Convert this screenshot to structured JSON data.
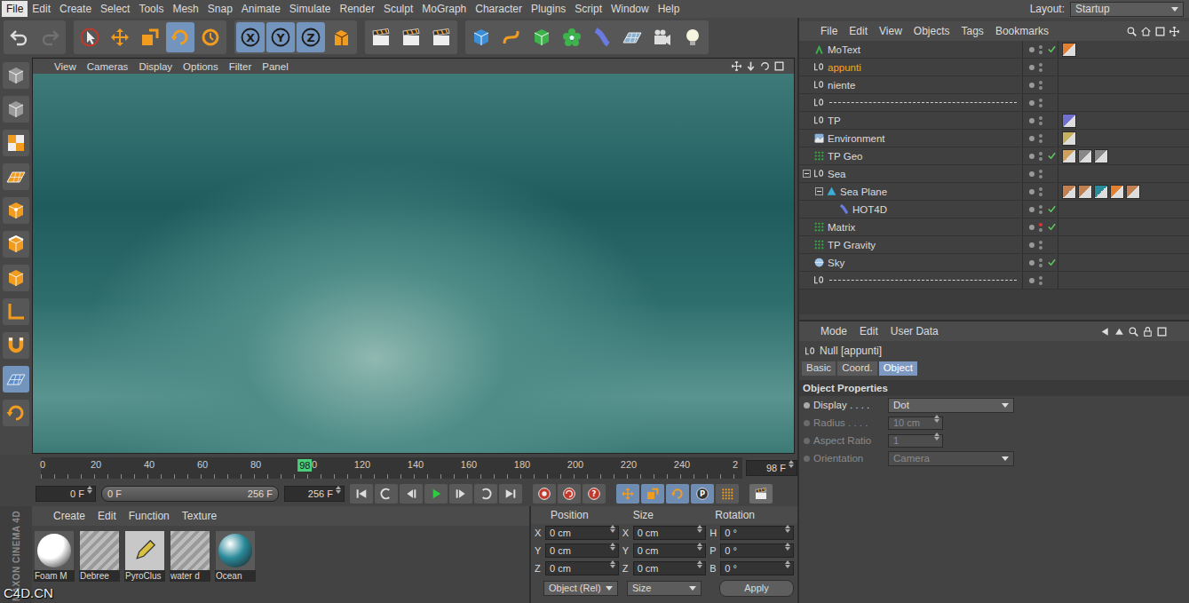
{
  "menubar": {
    "items": [
      {
        "label": "File",
        "selected": true
      },
      {
        "label": "Edit",
        "selected": false
      },
      {
        "label": "Create",
        "selected": false
      },
      {
        "label": "Select",
        "selected": false
      },
      {
        "label": "Tools",
        "selected": false
      },
      {
        "label": "Mesh",
        "selected": false
      },
      {
        "label": "Snap",
        "selected": false
      },
      {
        "label": "Animate",
        "selected": false
      },
      {
        "label": "Simulate",
        "selected": false
      },
      {
        "label": "Render",
        "selected": false
      },
      {
        "label": "Sculpt",
        "selected": false
      },
      {
        "label": "MoGraph",
        "selected": false
      },
      {
        "label": "Character",
        "selected": false
      },
      {
        "label": "Plugins",
        "selected": false
      },
      {
        "label": "Script",
        "selected": false
      },
      {
        "label": "Window",
        "selected": false
      },
      {
        "label": "Help",
        "selected": false
      }
    ],
    "layout_label": "Layout:",
    "layout_value": "Startup"
  },
  "toolbar": [
    {
      "tools": [
        {
          "kind": "undo",
          "label": "",
          "selected": false,
          "disabled": false
        },
        {
          "kind": "redo",
          "label": "",
          "selected": false,
          "disabled": true
        }
      ]
    },
    {
      "tools": [
        {
          "kind": "select",
          "label": "",
          "selected": false,
          "disabled": false
        },
        {
          "kind": "move",
          "label": "",
          "selected": false,
          "disabled": false
        },
        {
          "kind": "scale",
          "label": "",
          "selected": false,
          "disabled": false
        },
        {
          "kind": "rotate",
          "label": "",
          "selected": true,
          "disabled": false
        },
        {
          "kind": "recent",
          "label": "",
          "selected": false,
          "disabled": false
        }
      ]
    },
    {
      "tools": [
        {
          "kind": "axis",
          "label": "X",
          "selected": true,
          "disabled": false
        },
        {
          "kind": "axis",
          "label": "Y",
          "selected": true,
          "disabled": false
        },
        {
          "kind": "axis",
          "label": "Z",
          "selected": true,
          "disabled": false
        },
        {
          "kind": "coord",
          "label": "",
          "selected": false,
          "disabled": false
        }
      ]
    },
    {
      "tools": [
        {
          "kind": "clapper",
          "label": "",
          "selected": false,
          "disabled": false
        },
        {
          "kind": "clapper",
          "label": "",
          "selected": false,
          "disabled": false
        },
        {
          "kind": "clapper",
          "label": "",
          "selected": false,
          "disabled": false
        }
      ]
    },
    {
      "tools": [
        {
          "kind": "cube",
          "label": "",
          "selected": false,
          "disabled": false
        },
        {
          "kind": "spline",
          "label": "",
          "selected": false,
          "disabled": false
        },
        {
          "kind": "nurbs",
          "label": "",
          "selected": false,
          "disabled": false
        },
        {
          "kind": "array",
          "label": "",
          "selected": false,
          "disabled": false
        },
        {
          "kind": "deformer",
          "label": "",
          "selected": false,
          "disabled": false
        },
        {
          "kind": "floor",
          "label": "",
          "selected": false,
          "disabled": false
        },
        {
          "kind": "camera",
          "label": "",
          "selected": false,
          "disabled": false
        },
        {
          "kind": "light",
          "label": "",
          "selected": false,
          "disabled": false
        }
      ]
    }
  ],
  "left_tools": [
    {
      "kind": "model",
      "selected": false
    },
    {
      "kind": "object",
      "selected": false
    },
    {
      "kind": "texture",
      "selected": false
    },
    {
      "kind": "workplane",
      "selected": false
    },
    {
      "kind": "points",
      "selected": false
    },
    {
      "kind": "edges",
      "selected": false
    },
    {
      "kind": "polygons",
      "selected": false
    },
    {
      "kind": "axis-mode",
      "selected": false
    },
    {
      "kind": "tweak",
      "selected": false
    },
    {
      "kind": "snap",
      "selected": true
    },
    {
      "kind": "lock",
      "selected": false
    }
  ],
  "viewport": {
    "menu": [
      "View",
      "Cameras",
      "Display",
      "Options",
      "Filter",
      "Panel"
    ]
  },
  "timeline": {
    "ticks": [
      "0",
      "20",
      "40",
      "60",
      "80",
      "100",
      "120",
      "140",
      "160",
      "180",
      "200",
      "220",
      "240",
      "2"
    ],
    "playhead": {
      "label": "98",
      "level": 0.377
    },
    "current": "98 F"
  },
  "transport": {
    "start": "0 F",
    "range_start": "0 F",
    "range_end": "256 F",
    "end": "256 F",
    "playback": [
      {
        "kind": "first"
      },
      {
        "kind": "prevkey"
      },
      {
        "kind": "prevframe"
      },
      {
        "kind": "play"
      },
      {
        "kind": "nextframe"
      },
      {
        "kind": "nextkey"
      },
      {
        "kind": "last"
      }
    ],
    "record": [
      {
        "kind": "record",
        "label": ""
      },
      {
        "kind": "autokey",
        "label": ""
      },
      {
        "kind": "keysel",
        "label": "?"
      }
    ],
    "keys": [
      {
        "kind": "key-move",
        "label": "",
        "selected": true
      },
      {
        "kind": "key-scale",
        "label": "",
        "selected": true
      },
      {
        "kind": "key-rotate",
        "label": "",
        "selected": true
      },
      {
        "kind": "key-param",
        "label": "P",
        "selected": true
      },
      {
        "kind": "key-pla",
        "label": "",
        "selected": false
      }
    ]
  },
  "materials": {
    "menu": [
      "Create",
      "Edit",
      "Function",
      "Texture"
    ],
    "items": [
      {
        "name": "Foam M",
        "kind": "sphere",
        "color": "#ffffff"
      },
      {
        "name": "Debree",
        "kind": "hatch",
        "color": "#9a9a9a"
      },
      {
        "name": "PyroClus",
        "kind": "pyro",
        "color": "#d8c040"
      },
      {
        "name": "water d",
        "kind": "hatch",
        "color": "#9a9a9a"
      },
      {
        "name": "Ocean",
        "kind": "sphere",
        "color": "#2a8a9a"
      }
    ]
  },
  "coordinates": {
    "headers": [
      "Position",
      "Size",
      "Rotation"
    ],
    "rows": [
      [
        {
          "axis": "X",
          "value": "0 cm"
        },
        {
          "axis": "X",
          "value": "0 cm"
        },
        {
          "axis": "H",
          "value": "0 °"
        }
      ],
      [
        {
          "axis": "Y",
          "value": "0 cm"
        },
        {
          "axis": "Y",
          "value": "0 cm"
        },
        {
          "axis": "P",
          "value": "0 °"
        }
      ],
      [
        {
          "axis": "Z",
          "value": "0 cm"
        },
        {
          "axis": "Z",
          "value": "0 cm"
        },
        {
          "axis": "B",
          "value": "0 °"
        }
      ]
    ],
    "mode": "Object (Rel)",
    "size_mode": "Size",
    "apply": "Apply"
  },
  "objects": {
    "menu": [
      "File",
      "Edit",
      "View",
      "Objects",
      "Tags",
      "Bookmarks"
    ],
    "rows": [
      {
        "name": "MoText",
        "kind": "motext",
        "depth": 0,
        "parent": false,
        "expanded": false,
        "selected": false,
        "checked": true,
        "editor_off": false,
        "tags": [
          "#e08030"
        ]
      },
      {
        "name": "appunti",
        "kind": "null",
        "depth": 0,
        "parent": false,
        "expanded": false,
        "selected": true,
        "checked": false,
        "editor_off": false,
        "tags": []
      },
      {
        "name": "niente",
        "kind": "null",
        "depth": 0,
        "parent": false,
        "expanded": false,
        "selected": false,
        "checked": false,
        "editor_off": false,
        "tags": []
      },
      {
        "name": "",
        "kind": "separator",
        "depth": 0,
        "parent": false,
        "expanded": false,
        "selected": false,
        "checked": false,
        "editor_off": false,
        "tags": []
      },
      {
        "name": "TP",
        "kind": "null",
        "depth": 0,
        "parent": false,
        "expanded": false,
        "selected": false,
        "checked": false,
        "editor_off": false,
        "tags": [
          "#7070d0"
        ]
      },
      {
        "name": "Environment",
        "kind": "environment",
        "depth": 0,
        "parent": false,
        "expanded": false,
        "selected": false,
        "checked": false,
        "editor_off": false,
        "tags": [
          "#c8b060"
        ]
      },
      {
        "name": "TP Geo",
        "kind": "particles",
        "depth": 0,
        "parent": false,
        "expanded": false,
        "selected": false,
        "checked": true,
        "editor_off": false,
        "tags": [
          "#d0a060",
          "#888888",
          "#888888"
        ]
      },
      {
        "name": "Sea",
        "kind": "null",
        "depth": 0,
        "parent": true,
        "expanded": true,
        "selected": false,
        "checked": false,
        "editor_off": false,
        "tags": []
      },
      {
        "name": "Sea Plane",
        "kind": "sea",
        "depth": 1,
        "parent": true,
        "expanded": true,
        "selected": false,
        "checked": false,
        "editor_off": false,
        "tags": [
          "#c08050",
          "#c08050",
          "#2a8a9a",
          "#e08030",
          "#c08050"
        ]
      },
      {
        "name": "HOT4D",
        "kind": "hot4d",
        "depth": 2,
        "parent": false,
        "expanded": false,
        "selected": false,
        "checked": true,
        "editor_off": false,
        "tags": []
      },
      {
        "name": "Matrix",
        "kind": "particles",
        "depth": 0,
        "parent": false,
        "expanded": false,
        "selected": false,
        "checked": true,
        "editor_off": true,
        "tags": []
      },
      {
        "name": "TP Gravity",
        "kind": "particles",
        "depth": 0,
        "parent": false,
        "expanded": false,
        "selected": false,
        "checked": false,
        "editor_off": false,
        "tags": []
      },
      {
        "name": "Sky",
        "kind": "sky",
        "depth": 0,
        "parent": false,
        "expanded": false,
        "selected": false,
        "checked": true,
        "editor_off": false,
        "tags": []
      },
      {
        "name": "",
        "kind": "separator",
        "depth": 0,
        "parent": false,
        "expanded": false,
        "selected": false,
        "checked": false,
        "editor_off": false,
        "tags": []
      }
    ]
  },
  "attributes": {
    "menu": [
      "Mode",
      "Edit",
      "User Data"
    ],
    "title": "Null [appunti]",
    "tabs": [
      {
        "label": "Basic",
        "selected": false
      },
      {
        "label": "Coord.",
        "selected": false
      },
      {
        "label": "Object",
        "selected": true
      }
    ],
    "section": "Object Properties",
    "fields": [
      {
        "label": "Display . . . .",
        "value": "Dot",
        "kind": "dropdown",
        "disabled": false
      },
      {
        "label": "Radius . . . .",
        "value": "10 cm",
        "kind": "number",
        "disabled": true
      },
      {
        "label": "Aspect Ratio",
        "value": "1",
        "kind": "number",
        "disabled": true
      },
      {
        "label": "Orientation",
        "value": "Camera",
        "kind": "dropdown",
        "disabled": true
      }
    ]
  },
  "branding": {
    "logo": "MAXON CINEMA 4D",
    "watermark": "C4D.CN"
  }
}
